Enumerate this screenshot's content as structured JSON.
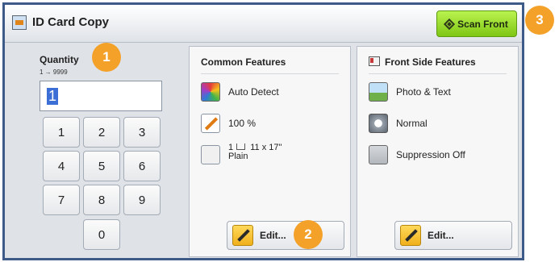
{
  "window": {
    "title": "ID Card Copy",
    "scan_label": "Scan Front"
  },
  "quantity": {
    "label": "Quantity",
    "range": "1 → 9999",
    "value": "1"
  },
  "keypad": [
    "1",
    "2",
    "3",
    "4",
    "5",
    "6",
    "7",
    "8",
    "9",
    "0"
  ],
  "common": {
    "title": "Common Features",
    "items": [
      {
        "label": "Auto Detect",
        "icon": "color-mode-icon"
      },
      {
        "label": "100 %",
        "icon": "reduce-enlarge-icon"
      },
      {
        "label": "1",
        "sub1": "11 x 17\"",
        "sub2": "Plain",
        "icon": "paper-supply-icon"
      }
    ],
    "edit_label": "Edit..."
  },
  "front": {
    "title": "Front Side Features",
    "items": [
      {
        "label": "Photo & Text",
        "icon": "photo-text-icon"
      },
      {
        "label": "Normal",
        "icon": "lighten-darken-icon"
      },
      {
        "label": "Suppression Off",
        "icon": "background-suppression-icon"
      }
    ],
    "edit_label": "Edit..."
  },
  "callouts": [
    "1",
    "2",
    "3"
  ],
  "colors": {
    "accent_green": "#8fd61f",
    "callout": "#f4a12a",
    "border": "#3d5a88"
  }
}
